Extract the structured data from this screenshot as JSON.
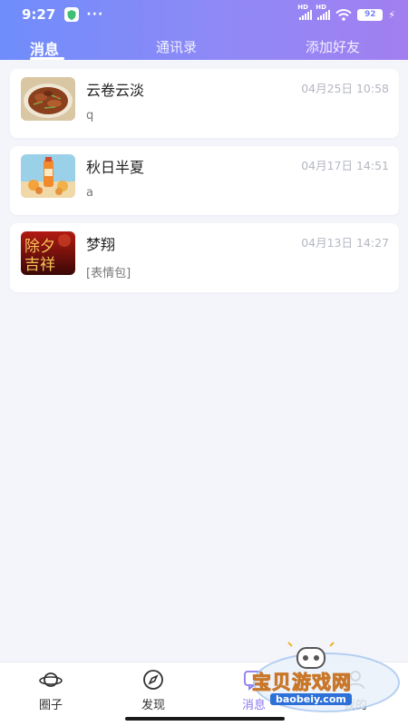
{
  "status": {
    "time": "9:27",
    "dots": "···",
    "battery": "92",
    "hd": "HD"
  },
  "tabs": [
    {
      "label": "消息"
    },
    {
      "label": "通讯录"
    },
    {
      "label": "添加好友"
    }
  ],
  "conversations": [
    {
      "name": "云卷云淡",
      "time": "04月25日 10:58",
      "preview": "q"
    },
    {
      "name": "秋日半夏",
      "time": "04月17日 14:51",
      "preview": "a"
    },
    {
      "name": "梦翔",
      "time": "04月13日 14:27",
      "preview": "[表情包]",
      "avatar_text": "除夕吉祥"
    }
  ],
  "bottom_nav": [
    {
      "label": "圈子"
    },
    {
      "label": "发现"
    },
    {
      "label": "消息"
    },
    {
      "label": "我的"
    }
  ],
  "watermark": {
    "title": "宝贝游戏网",
    "url": "baobeiy.com"
  },
  "colors": {
    "accent": "#8b78ef",
    "header_start": "#6f8dfb",
    "header_end": "#a27ff0"
  }
}
